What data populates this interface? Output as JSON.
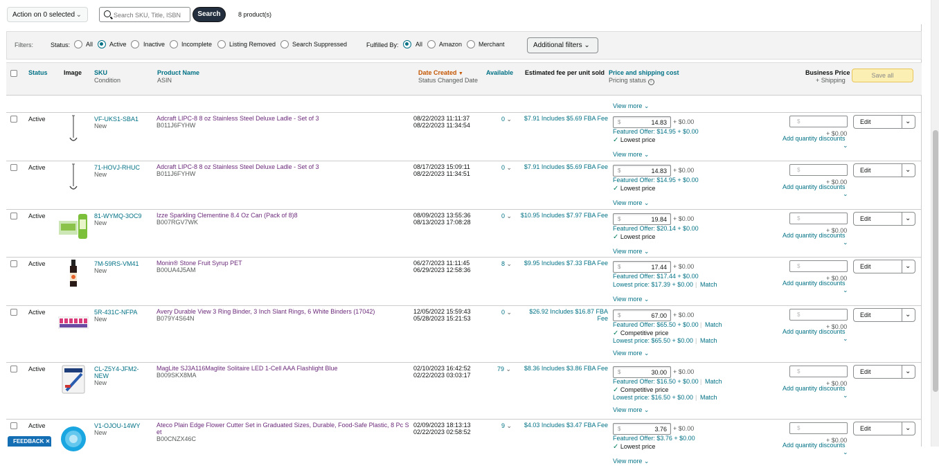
{
  "toolbar": {
    "action_label": "Action on 0 selected",
    "search_placeholder": "Search SKU, Title, ISBN",
    "search_button": "Search",
    "product_count": "8 product(s)"
  },
  "filters": {
    "label": "Filters:",
    "status_label": "Status:",
    "status_options": [
      "All",
      "Active",
      "Inactive",
      "Incomplete",
      "Listing Removed",
      "Search Suppressed"
    ],
    "status_selected": "Active",
    "fulfilled_label": "Fulfilled By:",
    "fulfilled_options": [
      "All",
      "Amazon",
      "Merchant"
    ],
    "fulfilled_selected": "All",
    "additional_label": "Additional filters"
  },
  "columns": {
    "status": "Status",
    "image": "Image",
    "sku": "SKU",
    "condition": "Condition",
    "product_name": "Product Name",
    "asin": "ASIN",
    "date_created": "Date Created",
    "status_changed": "Status Changed Date",
    "available": "Available",
    "fee": "Estimated fee per unit sold",
    "price": "Price and shipping cost",
    "pricing_status": "Pricing status",
    "business_price": "Business Price",
    "plus_shipping": "+ Shipping",
    "save_all": "Save all"
  },
  "common": {
    "view_more": "View more",
    "shipping": "+ $0.00",
    "biz_shipping": "+ $0.00",
    "qty_discounts": "Add quantity discounts",
    "edit": "Edit",
    "currency": "$",
    "match": "Match"
  },
  "rows": [
    {
      "status": "Active",
      "sku": "VF-UKS1-SBA1",
      "sku2": "",
      "condition": "New",
      "name": "Adcraft LIPC-8 8 oz Stainless Steel Deluxe Ladle - Set of 3",
      "name2": "",
      "asin": "B011J6FYHW",
      "created": "08/22/2023 11:11:37",
      "changed": "08/22/2023 11:34:54",
      "available": "0",
      "fee": "$7.91 Includes $5.69 FBA Fee",
      "fee2": "",
      "price": "14.83",
      "featured": "Featured Offer: $14.95 + $0.00",
      "featured_match": false,
      "badge": "Lowest price",
      "lowest": "",
      "lowest_match": false,
      "img": "ladle"
    },
    {
      "status": "Active",
      "sku": "71-HOVJ-RHUC",
      "sku2": "",
      "condition": "New",
      "name": "Adcraft LIPC-8 8 oz Stainless Steel Deluxe Ladle - Set of 3",
      "name2": "",
      "asin": "B011J6FYHW",
      "created": "08/17/2023 15:09:11",
      "changed": "08/22/2023 11:34:51",
      "available": "0",
      "fee": "$7.91 Includes $5.69 FBA Fee",
      "fee2": "",
      "price": "14.83",
      "featured": "Featured Offer: $14.95 + $0.00",
      "featured_match": false,
      "badge": "Lowest price",
      "lowest": "",
      "lowest_match": false,
      "img": "ladle"
    },
    {
      "status": "Active",
      "sku": "81-WYMQ-3OC9",
      "sku2": "",
      "condition": "New",
      "name": "Izze Sparkling Clementine 8.4 Oz Can (Pack of 8)8",
      "name2": "",
      "asin": "B007RGV7WK",
      "created": "08/09/2023 13:55:36",
      "changed": "08/13/2023 17:08:28",
      "available": "0",
      "fee": "$10.95 Includes $7.97 FBA Fee",
      "fee2": "",
      "price": "19.84",
      "featured": "Featured Offer: $20.14 + $0.00",
      "featured_match": false,
      "badge": "Lowest price",
      "lowest": "",
      "lowest_match": false,
      "img": "cans"
    },
    {
      "status": "Active",
      "sku": "7M-59RS-VM41",
      "sku2": "",
      "condition": "New",
      "name": "Monin® Stone Fruit Syrup PET",
      "name2": "",
      "asin": "B00UA4J5AM",
      "created": "06/27/2023 11:11:45",
      "changed": "06/29/2023 12:58:36",
      "available": "8",
      "fee": "$9.95 Includes $7.33 FBA Fee",
      "fee2": "",
      "price": "17.44",
      "featured": "Featured Offer: $17.44 + $0.00",
      "featured_match": false,
      "badge": "",
      "lowest": "Lowest price: $17.39 + $0.00",
      "lowest_match": true,
      "img": "bottle"
    },
    {
      "status": "Active",
      "sku": "5R-431C-NFPA",
      "sku2": "",
      "condition": "New",
      "name": "Avery Durable View 3 Ring Binder, 3 Inch Slant Rings, 6 White Binders (17042)",
      "name2": "",
      "asin": "B079Y4S64N",
      "created": "12/05/2022 15:59:43",
      "changed": "05/28/2023 15:21:53",
      "available": "0",
      "fee": "$26.92 Includes $16.87 FBA",
      "fee2": "Fee",
      "price": "67.00",
      "featured": "Featured Offer: $65.50 + $0.00",
      "featured_match": true,
      "badge": "Competitive price",
      "lowest": "Lowest price: $65.50 + $0.00",
      "lowest_match": true,
      "img": "binders"
    },
    {
      "status": "Active",
      "sku": "CL-Z5Y4-JFM2-",
      "sku2": "NEW",
      "condition": "New",
      "name": "MagLite SJ3A116Maglite Solitaire LED 1-Cell AAA Flashlight Blue",
      "name2": "",
      "asin": "B009SKX8MA",
      "created": "02/10/2023 16:42:52",
      "changed": "02/22/2023 03:03:17",
      "available": "79",
      "fee": "$8.36 Includes $3.86 FBA Fee",
      "fee2": "",
      "price": "30.00",
      "featured": "Featured Offer: $16.50 + $0.00",
      "featured_match": true,
      "badge": "Competitive price",
      "lowest": "Lowest price: $16.50 + $0.00",
      "lowest_match": true,
      "img": "flashlight"
    },
    {
      "status": "Active",
      "sku": "V1-OJOU-14WY",
      "sku2": "",
      "condition": "New",
      "name": "Ateco Plain Edge Flower Cutter Set in Graduated Sizes, Durable, Food-Safe Plastic, 8 Pc S",
      "name2": "et",
      "asin": "B00CNZX46C",
      "created": "02/09/2023 18:13:13",
      "changed": "02/22/2023 02:58:52",
      "available": "9",
      "fee": "$4.03 Includes $3.47 FBA Fee",
      "fee2": "",
      "price": "3.76",
      "featured": "Featured Offer: $3.76 + $0.00",
      "featured_match": false,
      "badge": "Lowest price",
      "lowest": "",
      "lowest_match": false,
      "img": "cutters"
    }
  ],
  "feedback": "FEEDBACK"
}
